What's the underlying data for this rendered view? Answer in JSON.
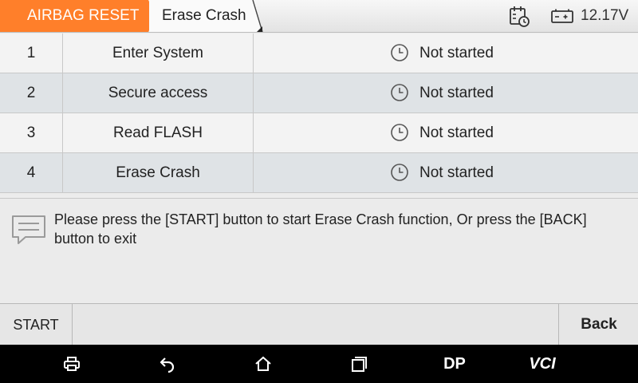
{
  "breadcrumb": {
    "items": [
      "AIRBAG RESET",
      "Erase Crash"
    ]
  },
  "status_bar": {
    "voltage": "12.17V"
  },
  "steps": [
    {
      "num": "1",
      "name": "Enter System",
      "status": "Not started"
    },
    {
      "num": "2",
      "name": "Secure access",
      "status": "Not started"
    },
    {
      "num": "3",
      "name": "Read FLASH",
      "status": "Not started"
    },
    {
      "num": "4",
      "name": "Erase Crash",
      "status": "Not started"
    }
  ],
  "message": {
    "text": "Please press the [START] button to start Erase Crash function, Or press the [BACK] button to exit"
  },
  "buttons": {
    "start": "START",
    "back": "Back"
  },
  "navbar": {
    "dp": "DP",
    "vci": "VCI"
  },
  "colors": {
    "accent": "#ff7f2a",
    "row_alt": "#dfe3e6",
    "navbar": "#000000"
  }
}
